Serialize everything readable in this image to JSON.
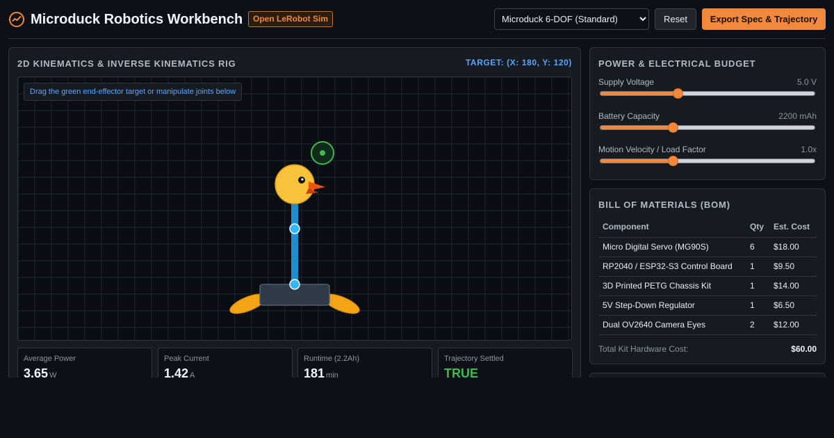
{
  "header": {
    "title": "Microduck Robotics Workbench",
    "sim_badge": "Open LeRobot Sim",
    "model_select": {
      "selected": "Microduck 6-DOF (Standard)"
    },
    "reset_label": "Reset",
    "export_label": "Export Spec & Trajectory",
    "logo_icon": "chart-pulse-icon"
  },
  "rig": {
    "title": "2D KINEMATICS & INVERSE KINEMATICS RIG",
    "target_readout": "TARGET: (X: 180, Y: 120)",
    "hint": "Drag the green end-effector target or manipulate joints below",
    "target_handle": "crosshair-target-icon",
    "colors": {
      "target": "#3fb950",
      "link": "#1f8ecf",
      "joint": "#39b6f5",
      "duck": "#f8c33a",
      "beak": "#f0540a",
      "feet": "#f6a417"
    }
  },
  "stats": [
    {
      "label": "Average Power",
      "value": "3.65",
      "unit": "W"
    },
    {
      "label": "Peak Current",
      "value": "1.42",
      "unit": "A"
    },
    {
      "label": "Runtime (2.2Ah)",
      "value": "181",
      "unit": "min"
    },
    {
      "label": "Trajectory Settled",
      "value": "TRUE",
      "unit": ""
    }
  ],
  "power": {
    "title": "POWER & ELECTRICAL BUDGET",
    "sliders": [
      {
        "label": "Supply Voltage",
        "value": "5.0 V",
        "fraction": 0.36
      },
      {
        "label": "Battery Capacity",
        "value": "2200 mAh",
        "fraction": 0.34
      },
      {
        "label": "Motion Velocity / Load Factor",
        "value": "1.0x",
        "fraction": 0.34
      }
    ]
  },
  "bom": {
    "title": "BILL OF MATERIALS (BOM)",
    "headers": [
      "Component",
      "Qty",
      "Est. Cost"
    ],
    "rows": [
      [
        "Micro Digital Servo (MG90S)",
        "6",
        "$18.00"
      ],
      [
        "RP2040 / ESP32-S3 Control Board",
        "1",
        "$9.50"
      ],
      [
        "3D Printed PETG Chassis Kit",
        "1",
        "$14.00"
      ],
      [
        "5V Step-Down Regulator",
        "1",
        "$6.50"
      ],
      [
        "Dual OV2640 Camera Eyes",
        "2",
        "$12.00"
      ]
    ],
    "total_label": "Total Kit Hardware Cost:",
    "total_value": "$60.00"
  },
  "theme": {
    "accent": "#f0883e",
    "link": "#58a6ff",
    "success": "#3fb950",
    "background": "#0d1117"
  }
}
